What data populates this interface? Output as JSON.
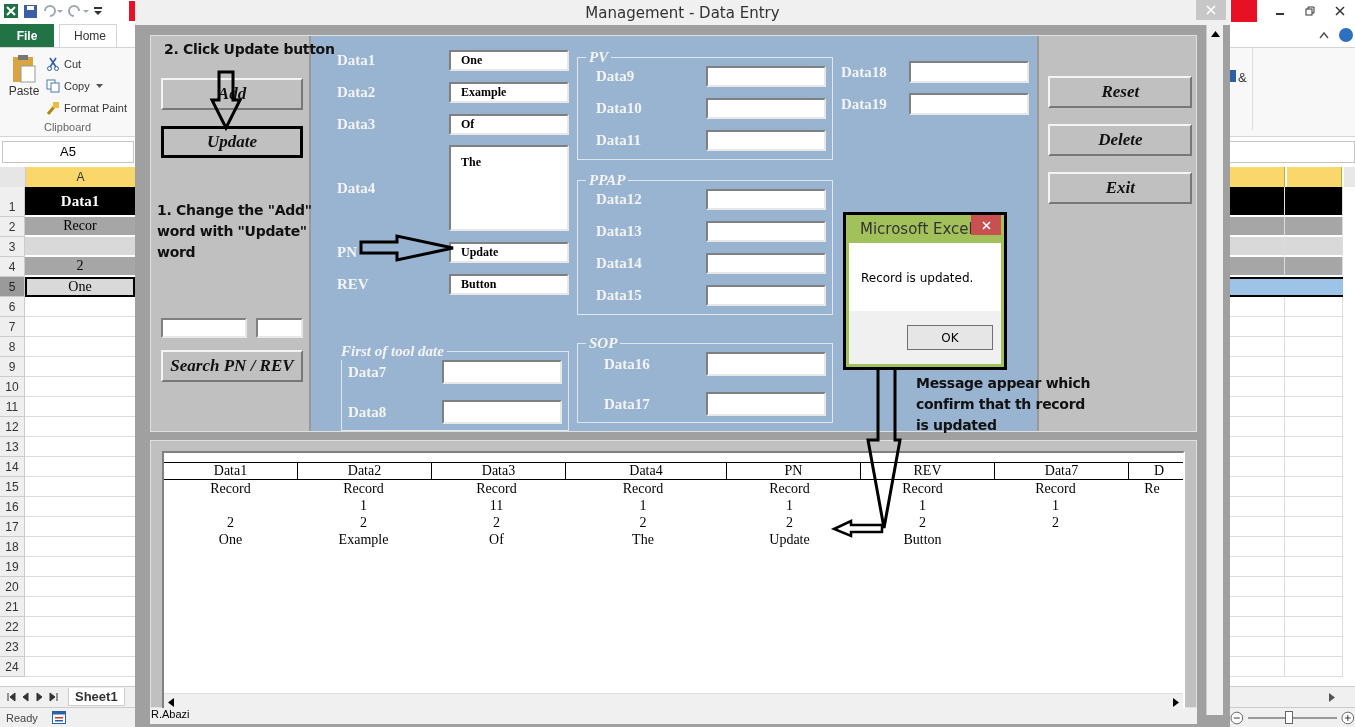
{
  "excel": {
    "tabs": [
      {
        "label": "File",
        "selected": false
      },
      {
        "label": "Home",
        "selected": true
      }
    ],
    "clipboard": {
      "paste": "Paste",
      "cut": "Cut",
      "copy": "Copy",
      "format_painter": "Format Paint",
      "group": "Clipboard"
    },
    "ribbon_fragment": "&",
    "name_box": "A5",
    "column_header": "A",
    "rows": [
      {
        "number": "1",
        "text": "Data1",
        "kind": "header"
      },
      {
        "number": "2",
        "text": "Recor",
        "kind": "dark"
      },
      {
        "number": "3",
        "kind": "light"
      },
      {
        "number": "4",
        "text": "2",
        "kind": "dark"
      },
      {
        "number": "5",
        "text": "One",
        "kind": "selected"
      },
      {
        "number": "6",
        "kind": "plain"
      },
      {
        "number": "7",
        "kind": "plain"
      },
      {
        "number": "8",
        "kind": "plain"
      },
      {
        "number": "9",
        "kind": "plain"
      },
      {
        "number": "10",
        "kind": "plain"
      },
      {
        "number": "11",
        "kind": "plain"
      },
      {
        "number": "12",
        "kind": "plain"
      },
      {
        "number": "13",
        "kind": "plain"
      },
      {
        "number": "14",
        "kind": "plain"
      },
      {
        "number": "15",
        "kind": "plain"
      },
      {
        "number": "16",
        "kind": "plain"
      },
      {
        "number": "17",
        "kind": "plain"
      },
      {
        "number": "18",
        "kind": "plain"
      },
      {
        "number": "19",
        "kind": "plain"
      },
      {
        "number": "20",
        "kind": "plain"
      },
      {
        "number": "21",
        "kind": "plain"
      },
      {
        "number": "22",
        "kind": "plain"
      },
      {
        "number": "23",
        "kind": "plain"
      },
      {
        "number": "24",
        "kind": "plain"
      }
    ],
    "sheet_tab": "Sheet1",
    "status": "Ready",
    "zoom": {
      "level": 0.45
    }
  },
  "form": {
    "title": "Management - Data Entry",
    "left_buttons": [
      {
        "label": "Add",
        "highlighted": false
      },
      {
        "label": "Update",
        "highlighted": true
      }
    ],
    "search_button": "Search PN / REV",
    "main_fields": [
      {
        "label": "Data1",
        "value": "One",
        "kind": "text"
      },
      {
        "label": "Data2",
        "value": "Example",
        "kind": "text"
      },
      {
        "label": "Data3",
        "value": "Of",
        "kind": "text"
      },
      {
        "label": "Data4",
        "value": "The",
        "kind": "multiline"
      },
      {
        "label": "PN",
        "value": "Update",
        "kind": "text"
      },
      {
        "label": "REV",
        "value": "Button",
        "kind": "text"
      }
    ],
    "tool_date_frame": {
      "title": "First of tool date",
      "fields": [
        {
          "label": "Data7"
        },
        {
          "label": "Data8"
        }
      ]
    },
    "frames": [
      {
        "title": "PV",
        "fields": [
          {
            "label": "Data9"
          },
          {
            "label": "Data10"
          },
          {
            "label": "Data11"
          }
        ]
      },
      {
        "title": "PPAP",
        "fields": [
          {
            "label": "Data12"
          },
          {
            "label": "Data13"
          },
          {
            "label": "Data14"
          },
          {
            "label": "Data15"
          }
        ]
      },
      {
        "title": "SOP",
        "fields": [
          {
            "label": "Data16"
          },
          {
            "label": "Data17"
          }
        ]
      }
    ],
    "extra_fields": [
      {
        "label": "Data18"
      },
      {
        "label": "Data19"
      }
    ],
    "right_buttons": [
      "Reset",
      "Delete",
      "Exit"
    ],
    "list": {
      "columns": [
        "Data1",
        "Data2",
        "Data3",
        "Data4",
        "PN",
        "REV",
        "Data7",
        "D"
      ],
      "rows": [
        [
          "Record",
          "Record",
          "Record",
          "Record",
          "Record",
          "Record",
          "Record",
          "Re"
        ],
        [
          null,
          "1",
          "11",
          "1",
          "1",
          "1",
          "1",
          null
        ],
        [
          "2",
          "2",
          "2",
          "2",
          "2",
          "2",
          "2",
          null
        ],
        [
          "One",
          "Example",
          "Of",
          "The",
          "Update",
          "Button",
          null,
          null
        ]
      ]
    },
    "status": "R.Abazi"
  },
  "message_box": {
    "title": "Microsoft Excel",
    "message": "Record is updated.",
    "button": "OK"
  },
  "annotations": [
    "2. Click Update button",
    "1. Change the \"Add\" word with \"Update\" word",
    "Message appear which confirm that th record is updated"
  ]
}
